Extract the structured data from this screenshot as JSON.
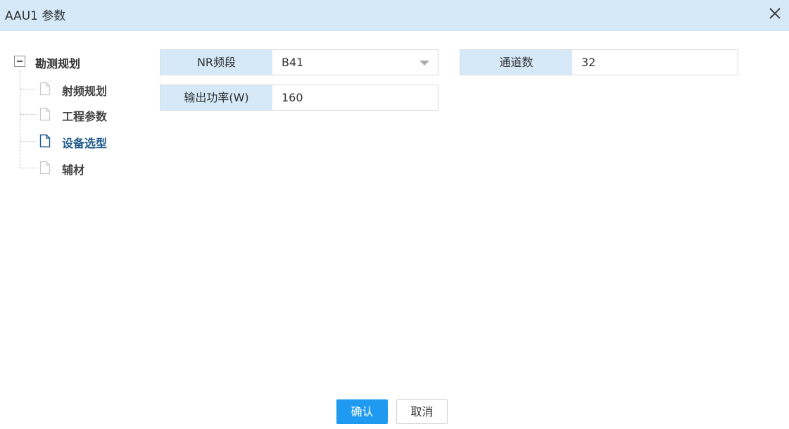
{
  "dialog": {
    "title": "AAU1 参数"
  },
  "tree": {
    "root_label": "勘测规划",
    "items": [
      {
        "label": "射频规划",
        "active": false
      },
      {
        "label": "工程参数",
        "active": false
      },
      {
        "label": "设备选型",
        "active": true
      },
      {
        "label": "辅材",
        "active": false
      }
    ]
  },
  "form": {
    "nr_band": {
      "label": "NR频段",
      "value": "B41"
    },
    "channels": {
      "label": "通道数",
      "value": "32"
    },
    "output_power": {
      "label": "输出功率(W)",
      "value": "160"
    }
  },
  "buttons": {
    "confirm": "确认",
    "cancel": "取消"
  },
  "colors": {
    "header_bg": "#d6e9f8",
    "primary": "#1e9bf0",
    "active_tree_item": "#1f5a8a"
  }
}
